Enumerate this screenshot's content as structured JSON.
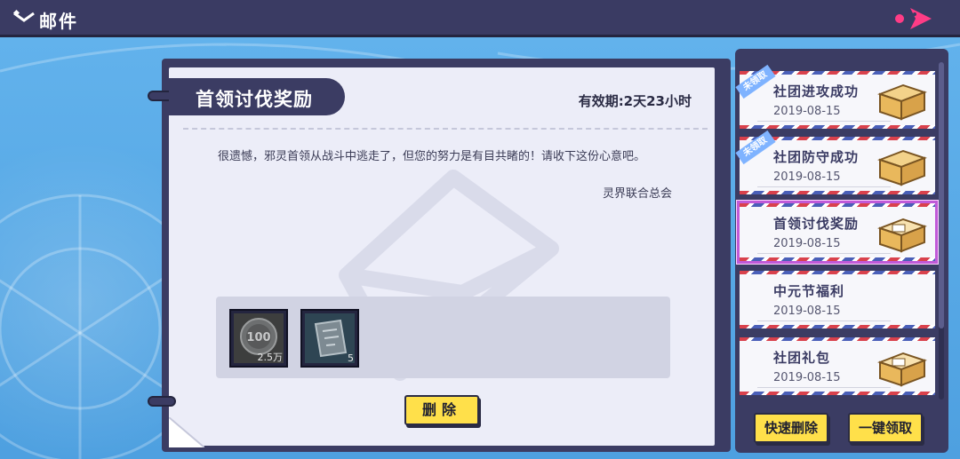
{
  "topbar": {
    "title": "邮件"
  },
  "mail": {
    "title": "首领讨伐奖励",
    "validity": "有效期:2天23小时",
    "body": "很遗憾，邪灵首领从战斗中逃走了，但您的努力是有目共睹的！请收下这份心意吧。",
    "sender": "灵界联合总会",
    "rewards": [
      {
        "icon": "coin-icon",
        "count": "2.5万"
      },
      {
        "icon": "ticket-icon",
        "count": "5"
      }
    ],
    "delete_label": "删除"
  },
  "mail_list": [
    {
      "title": "社团进攻成功",
      "date": "2019-08-15",
      "ribbon": "未领取",
      "has_box": true,
      "selected": false
    },
    {
      "title": "社团防守成功",
      "date": "2019-08-15",
      "ribbon": "未领取",
      "has_box": true,
      "selected": false
    },
    {
      "title": "首领讨伐奖励",
      "date": "2019-08-15",
      "ribbon": "",
      "has_box": true,
      "selected": true
    },
    {
      "title": "中元节福利",
      "date": "2019-08-15",
      "ribbon": "",
      "has_box": false,
      "selected": false
    },
    {
      "title": "社团礼包",
      "date": "2019-08-15",
      "ribbon": "",
      "has_box": true,
      "selected": false
    }
  ],
  "buttons": {
    "quick_delete": "快速删除",
    "claim_all": "一键领取"
  },
  "colors": {
    "panel": "#3b3c63",
    "paper": "#ecedf8",
    "button": "#ffe04a",
    "background": "#5aa9e6",
    "selected_outline": "#c05ad8"
  }
}
